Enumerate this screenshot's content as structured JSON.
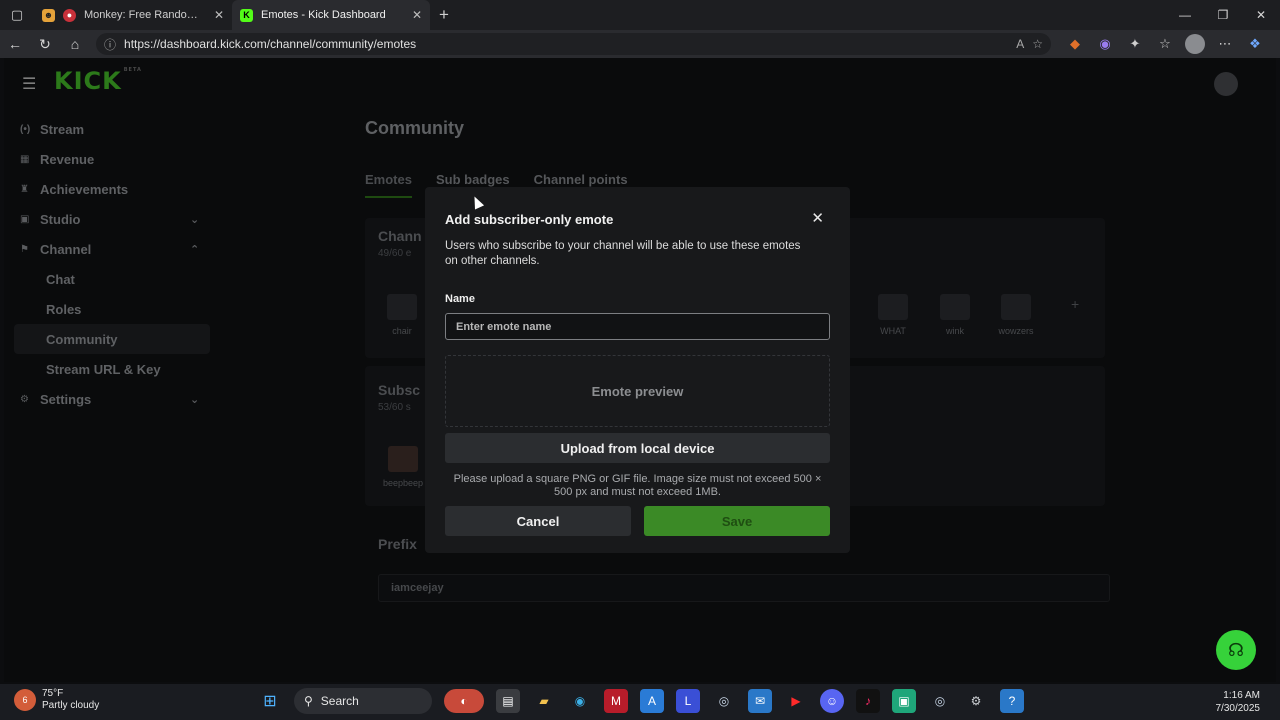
{
  "browser": {
    "tabs": [
      {
        "title": "Monkey: Free Random Video Chat",
        "active": false
      },
      {
        "title": "Emotes - Kick Dashboard",
        "active": true
      }
    ],
    "url": "https://dashboard.kick.com/channel/community/emotes"
  },
  "app": {
    "logo": "KICK",
    "logo_badge": "BETA"
  },
  "sidebar": {
    "items": [
      {
        "label": "Stream",
        "icon": "broadcast-icon"
      },
      {
        "label": "Revenue",
        "icon": "revenue-icon"
      },
      {
        "label": "Achievements",
        "icon": "trophy-icon"
      },
      {
        "label": "Studio",
        "icon": "studio-icon"
      },
      {
        "label": "Channel",
        "icon": "channel-icon"
      },
      {
        "label": "Settings",
        "icon": "gear-icon"
      }
    ],
    "channel_sub": [
      "Chat",
      "Roles",
      "Community",
      "Stream URL & Key"
    ]
  },
  "page": {
    "title": "Community",
    "tabs": [
      "Emotes",
      "Sub badges",
      "Channel points"
    ],
    "section1_title": "Chann",
    "section1_count": "49/60 e",
    "emotes": [
      "chair",
      "WHAT",
      "wink",
      "wowzers"
    ],
    "section2_title": "Subsc",
    "section2_count": "53/60 s",
    "sub_emote": "beepbeep",
    "prefix_title": "Prefix",
    "prefix_value": "iamceejay"
  },
  "modal": {
    "title": "Add subscriber-only emote",
    "description": "Users who subscribe to your channel will be able to use these emotes on other channels.",
    "name_label": "Name",
    "name_placeholder": "Enter emote name",
    "preview_label": "Emote preview",
    "upload_label": "Upload from local device",
    "hint": "Please upload a square PNG or GIF file. Image size must not exceed 500 × 500 px and must not exceed 1MB.",
    "cancel_label": "Cancel",
    "save_label": "Save"
  },
  "taskbar": {
    "weather_temp": "75°F",
    "weather_desc": "Partly cloudy",
    "weather_badge": "6",
    "search_label": "Search",
    "time": "1:16 AM",
    "date": "7/30/2025"
  },
  "colors": {
    "brand_green": "#53FC18",
    "save_green": "#3b8a26",
    "help_green": "#36d23a"
  }
}
